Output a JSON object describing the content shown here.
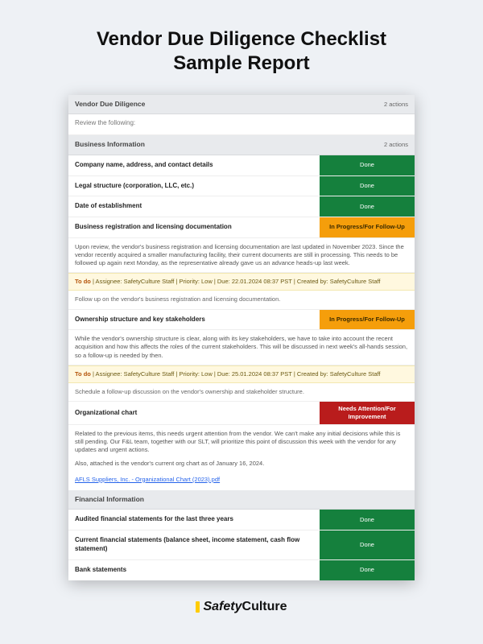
{
  "page": {
    "title_line1": "Vendor Due Diligence Checklist",
    "title_line2": "Sample Report"
  },
  "brand": {
    "name_prefix": "Safety",
    "name_suffix": "Culture"
  },
  "report": {
    "header": {
      "title": "Vendor Due Diligence",
      "actions": "2 actions"
    },
    "instruction": "Review the following:",
    "section_business": {
      "title": "Business Information",
      "actions": "2 actions",
      "items": [
        {
          "label": "Company name, address, and contact details",
          "status": "Done"
        },
        {
          "label": "Legal structure (corporation, LLC, etc.)",
          "status": "Done"
        },
        {
          "label": "Date of establishment",
          "status": "Done"
        }
      ],
      "item_reg": {
        "label": "Business registration and licensing documentation",
        "status": "In Progress/For Follow-Up",
        "note": "Upon review, the vendor's business registration and licensing documentation are last updated in November 2023. Since the vendor recently acquired a smaller manufacturing facility, their current documents are still in processing. This needs to be followed up again next Monday, as the representative already gave us an advance heads-up last week.",
        "todo": {
          "tag": "To do",
          "meta": " | Assignee: SafetyCulture Staff  |  Priority: Low  |  Due: 22.01.2024 08:37 PST  |  Created by: SafetyCulture Staff",
          "followup": "Follow up on the vendor's business registration and licensing documentation."
        }
      },
      "item_owner": {
        "label": "Ownership structure and key stakeholders",
        "status": "In Progress/For Follow-Up",
        "note": "While the vendor's ownership structure is clear, along with its key stakeholders, we have to take into account the recent acquisition and how this affects the roles of the current stakeholders. This will be discussed in next week's all-hands session, so a follow-up is needed by then.",
        "todo": {
          "tag": "To do",
          "meta": " | Assignee: SafetyCulture Staff  |  Priority: Low  |  Due: 25.01.2024 08:37 PST  |  Created by: SafetyCulture Staff",
          "followup": "Schedule a follow-up discussion on the vendor's ownership and stakeholder structure."
        }
      },
      "item_org": {
        "label": "Organizational chart",
        "status": "Needs Attention/For Improvement",
        "note": "Related to the previous items, this needs urgent attention from the vendor. We can't make any initial decisions while this is still pending. Our F&L team, together with our SLT, will prioritize this point of discussion this week with the vendor for any updates and urgent actions.",
        "note2": "Also, attached is the vendor's current org chart as of January 16, 2024.",
        "attachment": "AFLS Suppliers, Inc. - Organizational Chart (2023).pdf"
      }
    },
    "section_financial": {
      "title": "Financial Information",
      "items": [
        {
          "label": "Audited financial statements for the last three years",
          "status": "Done"
        },
        {
          "label": "Current financial statements (balance sheet, income statement, cash flow statement)",
          "status": "Done"
        },
        {
          "label": "Bank statements",
          "status": "Done"
        }
      ]
    }
  }
}
